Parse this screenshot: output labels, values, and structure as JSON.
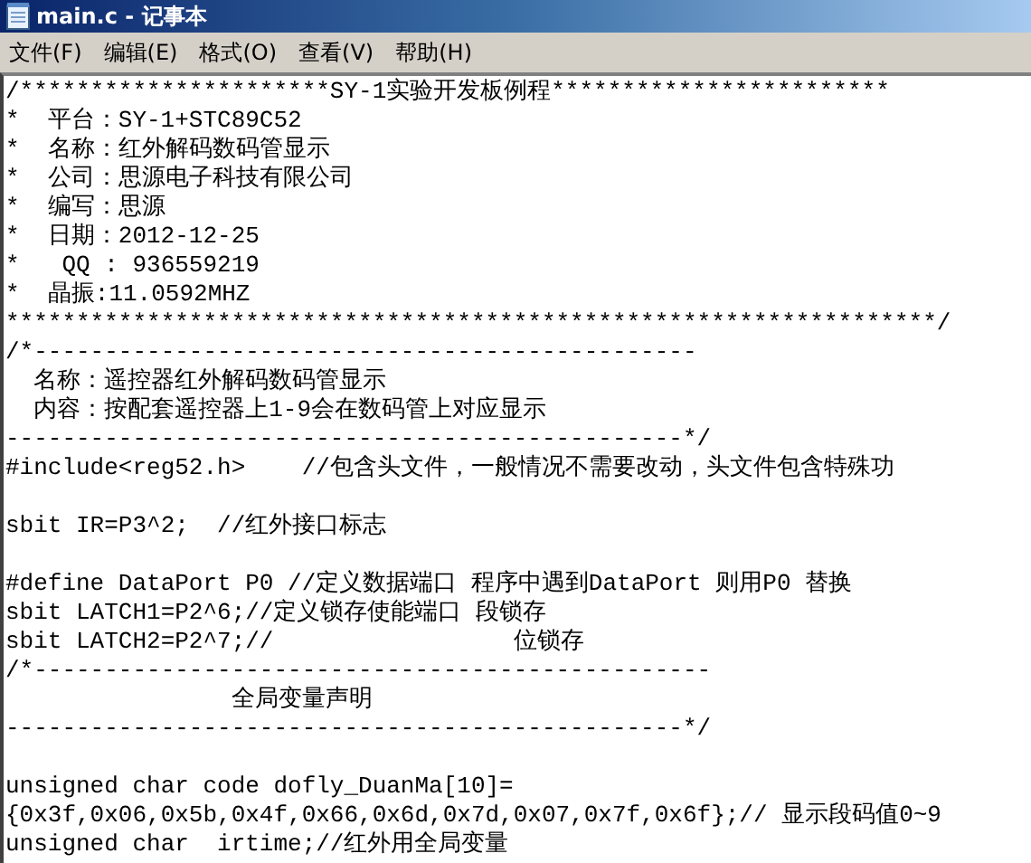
{
  "window": {
    "title": "main.c - 记事本"
  },
  "menu": [
    {
      "label": "文件(F)"
    },
    {
      "label": "编辑(E)"
    },
    {
      "label": "格式(O)"
    },
    {
      "label": "查看(V)"
    },
    {
      "label": "帮助(H)"
    }
  ],
  "editor": {
    "blocks": [
      [
        "/**********************SY-1实验开发板例程************************",
        "*  平台：SY-1+STC89C52",
        "*  名称：红外解码数码管显示",
        "*  公司：思源电子科技有限公司",
        "*  编写：思源",
        "*  日期：2012-12-25",
        "*   QQ : 936559219",
        "*  晶振:11.0592MHZ",
        "******************************************************************/",
        "/*-----------------------------------------------",
        "  名称：遥控器红外解码数码管显示",
        "  内容：按配套遥控器上1-9会在数码管上对应显示",
        "------------------------------------------------*/",
        "#include<reg52.h>    //包含头文件，一般情况不需要改动，头文件包含特殊功"
      ],
      [
        "sbit IR=P3^2;  //红外接口标志"
      ],
      [
        "#define DataPort P0 //定义数据端口 程序中遇到DataPort 则用P0 替换",
        "sbit LATCH1=P2^6;//定义锁存使能端口 段锁存",
        "sbit LATCH2=P2^7;//                 位锁存",
        "/*------------------------------------------------",
        "                全局变量声明",
        "------------------------------------------------*/"
      ],
      [
        "unsigned char code dofly_DuanMa[10]=",
        "{0x3f,0x06,0x5b,0x4f,0x66,0x6d,0x7d,0x07,0x7f,0x6f};// 显示段码值0~9",
        "unsigned char  irtime;//红外用全局变量"
      ]
    ]
  }
}
